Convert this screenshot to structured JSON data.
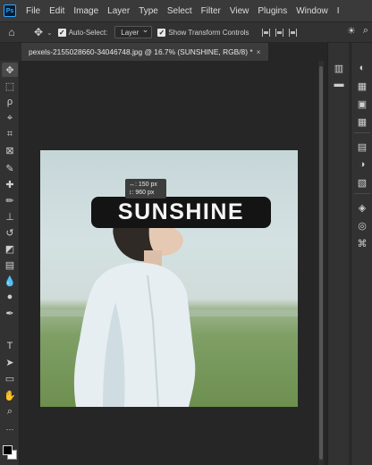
{
  "app": {
    "logo": "Ps",
    "menu": [
      "File",
      "Edit",
      "Image",
      "Layer",
      "Type",
      "Select",
      "Filter",
      "View",
      "Plugins",
      "Window",
      "I"
    ]
  },
  "options_bar": {
    "auto_select_label": "Auto-Select:",
    "auto_select_checked": true,
    "target_value": "Layer",
    "transform_controls_label": "Show Transform Controls",
    "transform_controls_checked": true
  },
  "document": {
    "tab_title": "pexels-2155028660-34046748.jpg @ 16.7% (SUNSHINE, RGB/8) *",
    "close_glyph": "×"
  },
  "canvas": {
    "text_layer": "SUNSHINE",
    "hud_x": "↔: 150 px",
    "hud_y": "↕: 960 px"
  },
  "tools": [
    "move-tool",
    "marquee-tool",
    "lasso-tool",
    "object-select-tool",
    "crop-tool",
    "frame-tool",
    "eyedropper-tool",
    "spot-healing-tool",
    "brush-tool",
    "stamp-tool",
    "history-brush-tool",
    "eraser-tool",
    "gradient-tool",
    "blur-tool",
    "dodge-tool",
    "pen-tool",
    "type-tool",
    "path-select-tool",
    "rectangle-tool",
    "hand-tool",
    "zoom-tool"
  ],
  "colors": {
    "foreground": "#000000",
    "background": "#ffffff",
    "accent": "#31a8ff"
  }
}
